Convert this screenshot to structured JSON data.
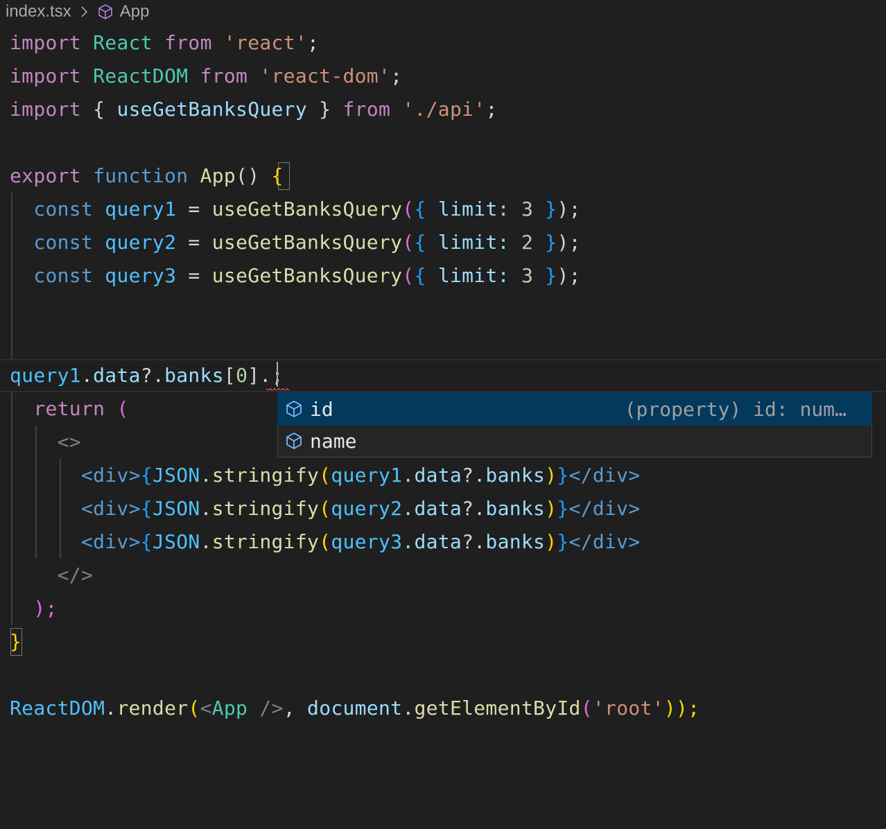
{
  "breadcrumb": {
    "file": "index.tsx",
    "separator_icon": "chevron-right-icon",
    "symbol_icon": "cube-icon",
    "symbol": "App"
  },
  "code": {
    "line1": {
      "t1": "import",
      "t2": "React",
      "t3": "from",
      "t4": "'react'",
      "t5": ";"
    },
    "line2": {
      "t1": "import",
      "t2": "ReactDOM",
      "t3": "from",
      "t4": "'react-dom'",
      "t5": ";"
    },
    "line3": {
      "t1": "import",
      "t2": "{",
      "t3": "useGetBanksQuery",
      "t4": "}",
      "t5": "from",
      "t6": "'./api'",
      "t7": ";"
    },
    "line5": {
      "t1": "export",
      "t2": "function",
      "t3": "App",
      "t4": "()",
      "t5": "{"
    },
    "line6": {
      "t1": "const",
      "t2": "query1",
      "t3": "=",
      "t4": "useGetBanksQuery",
      "t5": "(",
      "t6": "{",
      "t7": "limit:",
      "t8": "3",
      "t9": "}",
      "t10": ");"
    },
    "line7": {
      "t1": "const",
      "t2": "query2",
      "t3": "=",
      "t4": "useGetBanksQuery",
      "t5": "(",
      "t6": "{",
      "t7": "limit:",
      "t8": "2",
      "t9": "}",
      "t10": ");"
    },
    "line8": {
      "t1": "const",
      "t2": "query3",
      "t3": "=",
      "t4": "useGetBanksQuery",
      "t5": "(",
      "t6": "{",
      "t7": "limit:",
      "t8": "3",
      "t9": "}",
      "t10": ");"
    },
    "line11": {
      "t1": "query1",
      "t2": ".",
      "t3": "data",
      "t4": "?.",
      "t5": "banks",
      "t6": "[",
      "t7": "0",
      "t8": "]",
      "t9": ".",
      "t10": ";"
    },
    "line12": {
      "t1": "return",
      "t2": "("
    },
    "line13": {
      "t1": "<>"
    },
    "line14": {
      "open": "<div>",
      "b1": "{",
      "fn": "JSON",
      "dot": ".",
      "m": "stringify",
      "p1": "(",
      "q": "query1",
      "d": ".data",
      "op": "?.",
      "f": "banks",
      "p2": ")",
      "b2": "}",
      "close": "</div>"
    },
    "line15": {
      "open": "<div>",
      "b1": "{",
      "fn": "JSON",
      "dot": ".",
      "m": "stringify",
      "p1": "(",
      "q": "query2",
      "d": ".data",
      "op": "?.",
      "f": "banks",
      "p2": ")",
      "b2": "}",
      "close": "</div>"
    },
    "line16": {
      "open": "<div>",
      "b1": "{",
      "fn": "JSON",
      "dot": ".",
      "m": "stringify",
      "p1": "(",
      "q": "query3",
      "d": ".data",
      "op": "?.",
      "f": "banks",
      "p2": ")",
      "b2": "}",
      "close": "</div>"
    },
    "line17": {
      "t1": "</>"
    },
    "line18": {
      "t1": ");"
    },
    "line19": {
      "t1": "}"
    },
    "line21": {
      "t1": "ReactDOM",
      "t2": ".",
      "t3": "render",
      "t4": "(",
      "t5": "<",
      "t6": "App",
      "t7": " />",
      "t8": ",",
      "t9": "document",
      "t10": ".",
      "t11": "getElementById",
      "t12": "(",
      "t13": "'root'",
      "t14": "));"
    }
  },
  "suggest": {
    "items": [
      {
        "icon": "property-cube-icon",
        "label": "id",
        "detail": "(property) id: num…"
      },
      {
        "icon": "property-cube-icon",
        "label": "name",
        "detail": ""
      }
    ]
  }
}
